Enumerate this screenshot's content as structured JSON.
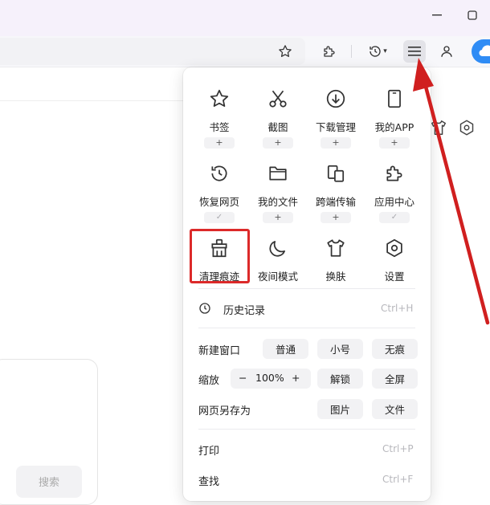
{
  "window": {
    "minimize_icon": "minimize-icon",
    "restore_icon": "restore-icon"
  },
  "toolbar": {
    "icons": [
      "star-icon",
      "puzzle-icon",
      "history-icon",
      "menu-icon",
      "user-icon",
      "cloud-icon"
    ],
    "history_dropdown_glyph": "▾"
  },
  "page": {
    "search_button_label": "搜索"
  },
  "menu": {
    "grid_rows": [
      [
        {
          "label": "书签",
          "icon": "star-icon",
          "badge": "+"
        },
        {
          "label": "截图",
          "icon": "scissors-icon",
          "badge": "+"
        },
        {
          "label": "下载管理",
          "icon": "download-icon",
          "badge": "+"
        },
        {
          "label": "我的APP",
          "icon": "phone-icon",
          "badge": "+"
        }
      ],
      [
        {
          "label": "恢复网页",
          "icon": "history-icon",
          "badge": "✓"
        },
        {
          "label": "我的文件",
          "icon": "folder-icon",
          "badge": "+"
        },
        {
          "label": "跨端传输",
          "icon": "transfer-icon",
          "badge": "+"
        },
        {
          "label": "应用中心",
          "icon": "puzzle-icon",
          "badge": "✓"
        }
      ],
      [
        {
          "label": "清理痕迹",
          "icon": "broom-icon"
        },
        {
          "label": "夜间模式",
          "icon": "moon-icon"
        },
        {
          "label": "换肤",
          "icon": "tshirt-icon"
        },
        {
          "label": "设置",
          "icon": "settings-icon"
        }
      ]
    ],
    "history": {
      "label": "历史记录",
      "shortcut": "Ctrl+H",
      "icon": "clock-icon"
    },
    "new_window": {
      "label": "新建窗口",
      "options": [
        "普通",
        "小号",
        "无痕"
      ]
    },
    "zoom": {
      "label": "缩放",
      "minus": "−",
      "value": "100%",
      "plus": "+",
      "unlock": "解锁",
      "fullscreen": "全屏"
    },
    "save_as": {
      "label": "网页另存为",
      "options": [
        "图片",
        "文件"
      ]
    },
    "print": {
      "label": "打印",
      "shortcut": "Ctrl+P"
    },
    "find": {
      "label": "查找",
      "shortcut": "Ctrl+F"
    }
  },
  "annotation": {
    "highlight_color": "#dc2a2a",
    "arrow_color": "#d01f1f"
  }
}
